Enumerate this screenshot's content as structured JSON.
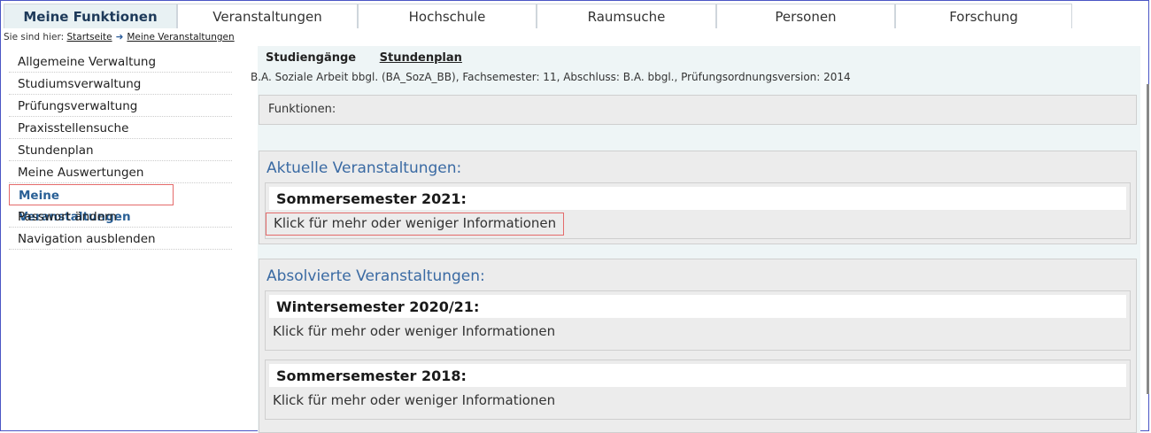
{
  "topnav": {
    "tabs": [
      {
        "label": "Meine Funktionen",
        "active": true
      },
      {
        "label": "Veranstaltungen",
        "active": false
      },
      {
        "label": "Hochschule",
        "active": false
      },
      {
        "label": "Raumsuche",
        "active": false
      },
      {
        "label": "Personen",
        "active": false
      },
      {
        "label": "Forschung",
        "active": false
      }
    ]
  },
  "breadcrumb": {
    "prefix": "Sie sind hier:",
    "home": "Startseite",
    "arrow": "➜",
    "current": "Meine Veranstaltungen"
  },
  "sidebar": {
    "items": [
      {
        "label": "Allgemeine Verwaltung"
      },
      {
        "label": "Studiumsverwaltung"
      },
      {
        "label": "Prüfungsverwaltung"
      },
      {
        "label": "Praxisstellensuche"
      },
      {
        "label": "Stundenplan"
      },
      {
        "label": "Meine Auswertungen"
      },
      {
        "label": "Meine Veranstaltungen",
        "active": true
      },
      {
        "label": "Passwort ändern"
      },
      {
        "label": "Navigation ausblenden"
      }
    ]
  },
  "main": {
    "subtabs": {
      "studiengaenge": "Studiengänge",
      "stundenplan": "Stundenplan"
    },
    "program": "B.A. Soziale Arbeit bbgl. (BA_SozA_BB), Fachsemester: 11, Abschluss: B.A. bbgl., Prüfungsordnungsversion: 2014",
    "functions_label": "Funktionen:",
    "current": {
      "title": "Aktuelle Veranstaltungen:",
      "semesters": [
        {
          "name": "Sommersemester 2021:",
          "info": "Klick für mehr oder weniger Informationen"
        }
      ]
    },
    "completed": {
      "title": "Absolvierte Veranstaltungen:",
      "semesters": [
        {
          "name": "Wintersemester 2020/21:",
          "info": "Klick für mehr oder weniger Informationen"
        },
        {
          "name": "Sommersemester 2018:",
          "info": "Klick für mehr oder weniger Informationen"
        }
      ]
    }
  }
}
